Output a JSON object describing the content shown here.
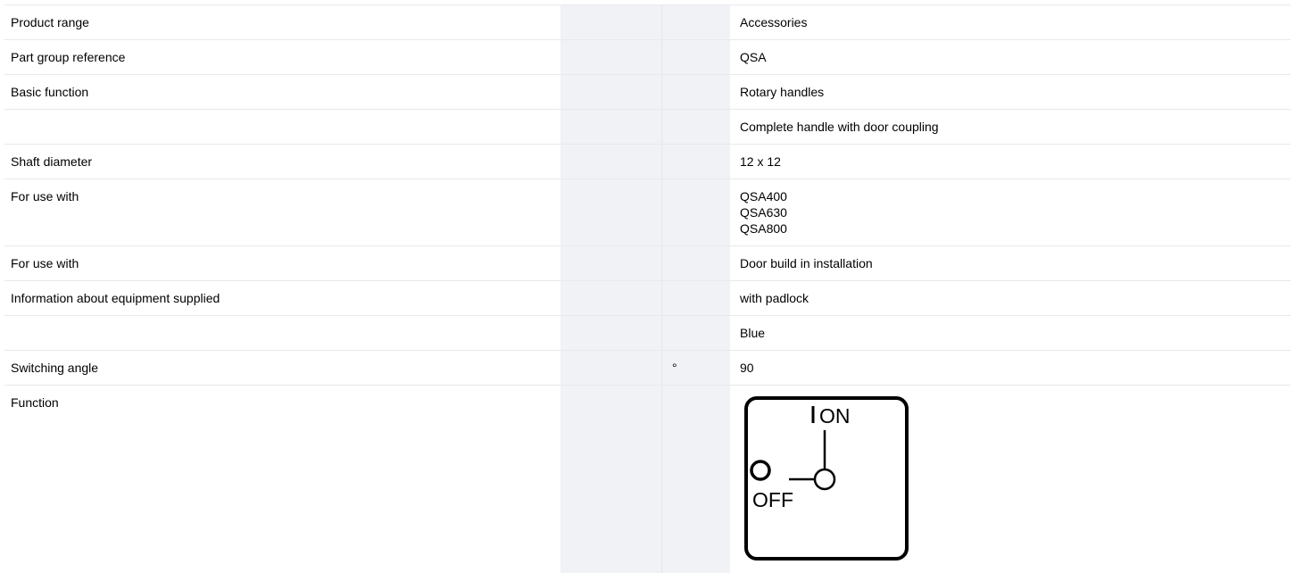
{
  "rows": [
    {
      "label": "Product range",
      "unit": "",
      "values": [
        "Accessories"
      ]
    },
    {
      "label": "Part group reference",
      "unit": "",
      "values": [
        "QSA"
      ]
    },
    {
      "label": "Basic function",
      "unit": "",
      "values": [
        "Rotary handles"
      ]
    },
    {
      "label": "",
      "unit": "",
      "values": [
        "Complete handle with door coupling"
      ]
    },
    {
      "label": "Shaft diameter",
      "unit": "",
      "values": [
        "12 x 12"
      ]
    },
    {
      "label": "For use with",
      "unit": "",
      "values": [
        "QSA400",
        "QSA630",
        "QSA800"
      ]
    },
    {
      "label": "For use with",
      "unit": "",
      "values": [
        "Door build in installation"
      ]
    },
    {
      "label": "Information about equipment supplied",
      "unit": "",
      "values": [
        "with padlock"
      ]
    },
    {
      "label": "",
      "unit": "",
      "values": [
        "Blue"
      ]
    },
    {
      "label": "Switching angle",
      "unit": "°",
      "values": [
        "90"
      ]
    },
    {
      "label": "Function",
      "unit": "",
      "values": []
    }
  ],
  "function_diagram": {
    "on_text": "ON",
    "off_text": "OFF",
    "icon": "on-off-rotary-switch-diagram-icon"
  },
  "colors": {
    "band": "#f1f2f6",
    "rule": "#e8e9ee",
    "text": "#000000"
  }
}
